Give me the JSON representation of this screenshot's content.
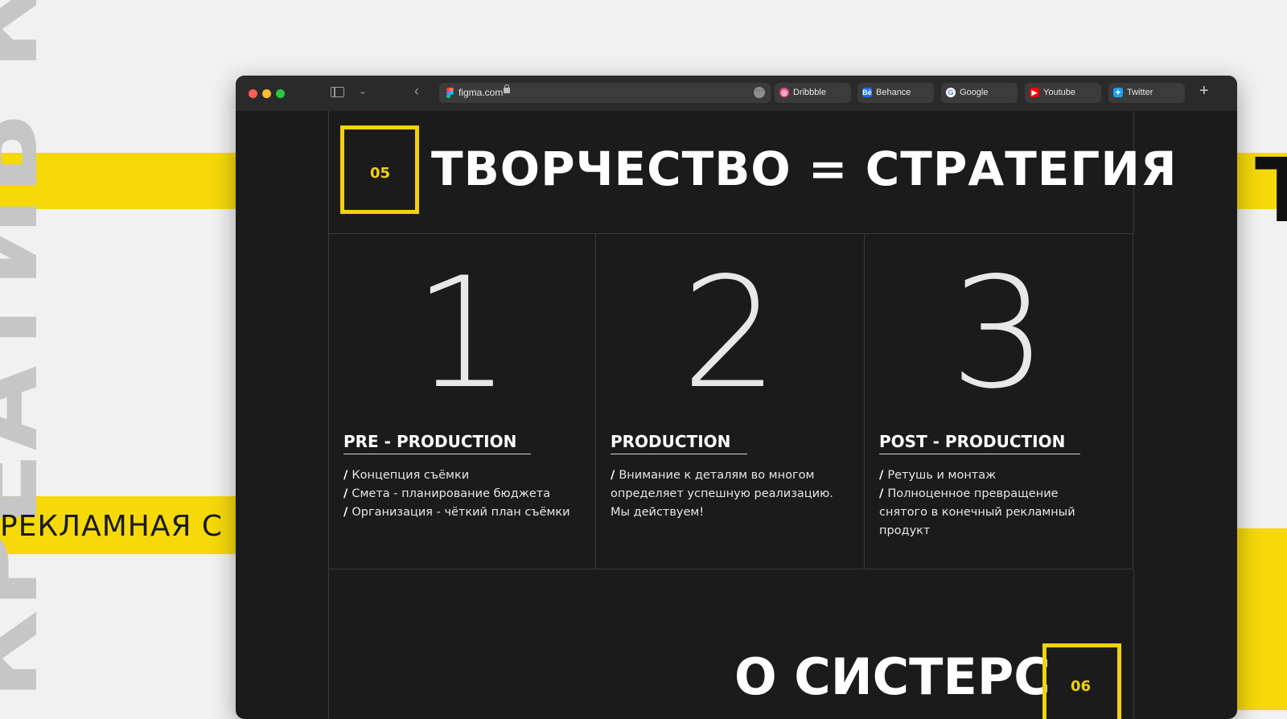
{
  "background": {
    "vertical_word": "КРЕАТИВ КР",
    "side_label": "РЕКЛАМНАЯ С",
    "right_glyph": "Т",
    "accent_color": "#f5d90a"
  },
  "browser": {
    "url": "figma.com",
    "more_icon": "ellipsis-icon",
    "bookmarks": [
      {
        "label": "Dribbble",
        "icon": "dribbble-icon",
        "color": "#ea4c89"
      },
      {
        "label": "Behance",
        "icon": "behance-icon",
        "color": "#1769ff"
      },
      {
        "label": "Google",
        "icon": "google-icon",
        "color": "#4285f4"
      },
      {
        "label": "Youtube",
        "icon": "youtube-icon",
        "color": "#ff0000"
      },
      {
        "label": "Twitter",
        "icon": "twitter-icon",
        "color": "#1da1f2"
      }
    ]
  },
  "slide": {
    "section_number": "05",
    "headline": "ТВОРЧЕСТВО = СТРАТЕГИЯ",
    "steps": [
      {
        "number": "1",
        "title": "PRE - PRODUCTION",
        "lines": [
          "Концепция съёмки",
          "Смета - планирование бюджета",
          "Организация - чёткий план съёмки"
        ]
      },
      {
        "number": "2",
        "title": "PRODUCTION",
        "lines": [
          "Внимание к деталям во многом",
          "определяет успешную реализацию.",
          "Мы действуем!"
        ]
      },
      {
        "number": "3",
        "title": "POST - PRODUCTION",
        "lines": [
          "Ретушь и монтаж",
          "Полноценное превращение",
          "снятого в конечный рекламный",
          "продукт"
        ]
      }
    ],
    "next_section_title": "О СИСТЕРС",
    "next_section_number": "06"
  }
}
